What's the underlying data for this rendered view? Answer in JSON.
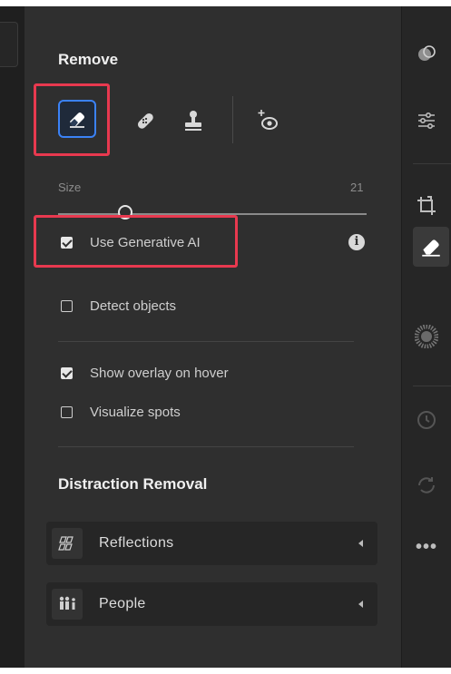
{
  "panel": {
    "title": "Remove",
    "size": {
      "label": "Size",
      "value": "21",
      "slider_fraction": 0.22
    },
    "options": [
      {
        "label": "Use Generative AI",
        "checked": true
      },
      {
        "label": "Detect objects",
        "checked": false
      },
      {
        "label": "Show overlay on hover",
        "checked": true
      },
      {
        "label": "Visualize spots",
        "checked": false
      }
    ],
    "distraction": {
      "title": "Distraction Removal",
      "items": [
        {
          "label": "Reflections",
          "icon": "reflections-icon"
        },
        {
          "label": "People",
          "icon": "people-icon"
        }
      ]
    }
  },
  "tools": [
    "eraser-icon",
    "bandage-icon",
    "clone-stamp-icon",
    "red-eye-icon"
  ],
  "right_toolbar": [
    "edit-icon",
    "adjust-sliders-icon",
    "crop-icon",
    "remove-eraser-icon",
    "masking-icon",
    "history-icon",
    "sync-icon",
    "more-icon"
  ],
  "colors": {
    "highlight": "#e8394f",
    "selected": "#3b82f6",
    "panel": "#2f2f2f"
  }
}
